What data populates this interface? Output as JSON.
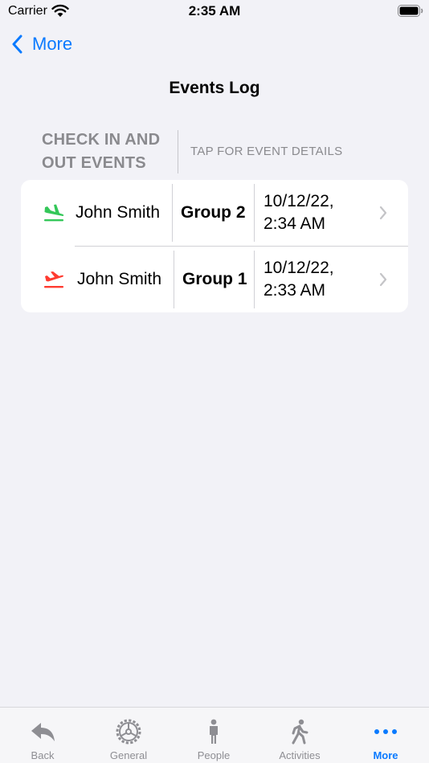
{
  "status_bar": {
    "carrier": "Carrier",
    "time": "2:35 AM"
  },
  "nav": {
    "back_label": "More",
    "title": "Events Log"
  },
  "section": {
    "header_left": "CHECK IN AND OUT EVENTS",
    "header_right": "TAP FOR EVENT DETAILS"
  },
  "events": [
    {
      "type": "check-in",
      "icon": "plane-arrival-icon",
      "icon_color": "#34c759",
      "name": "John Smith",
      "group": "Group 2",
      "date": "10/12/22,",
      "time": "2:34 AM"
    },
    {
      "type": "check-out",
      "icon": "plane-departure-icon",
      "icon_color": "#ff3b30",
      "name": "John Smith",
      "group": "Group 1",
      "date": "10/12/22,",
      "time": "2:33 AM"
    }
  ],
  "tabs": [
    {
      "label": "Back",
      "icon": "reply-arrow-icon"
    },
    {
      "label": "General",
      "icon": "gear-icon"
    },
    {
      "label": "People",
      "icon": "person-icon"
    },
    {
      "label": "Activities",
      "icon": "walking-person-icon"
    },
    {
      "label": "More",
      "icon": "ellipsis-icon",
      "active": true
    }
  ],
  "colors": {
    "accent": "#0a7aff",
    "background": "#f2f2f7",
    "secondary_text": "#8a8a8e"
  }
}
